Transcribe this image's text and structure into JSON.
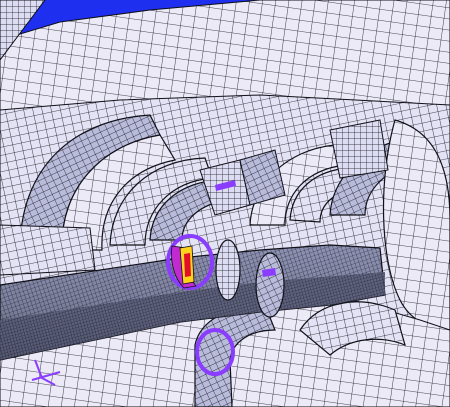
{
  "colors": {
    "background_sky": "#1e2ff0",
    "mesh_face": "#dcdcf2",
    "mesh_face_light": "#eceaf7",
    "mesh_face_shade": "#b9bbdb",
    "mesh_line": "#101018",
    "shaft_dark": "#2a2d3a",
    "shaft_face": "#9ea2c2",
    "highlight_violet": "#8a3cff",
    "highlight_magenta": "#c02ad0",
    "highlight_red": "#e0102a",
    "highlight_yellow": "#ffd21e"
  }
}
